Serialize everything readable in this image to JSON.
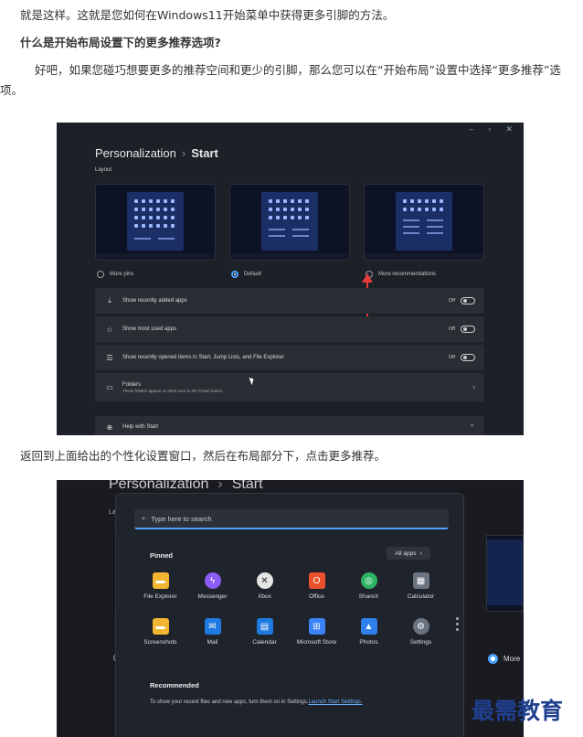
{
  "article": {
    "p1": "就是这样。这就是您如何在Windows11开始菜单中获得更多引脚的方法。",
    "heading": "什么是开始布局设置下的更多推荐选项?",
    "p2": "好吧，如果您碰巧想要更多的推荐空间和更少的引脚，那么您可以在“开始布局”设置中选择“更多推荐”选项。",
    "caption": "返回到上面给出的个性化设置窗口，然后在布局部分下，点击更多推荐。"
  },
  "shot1": {
    "window_controls": [
      "–",
      "▫",
      "✕"
    ],
    "breadcrumb_parent": "Personalization",
    "breadcrumb_sep": "›",
    "breadcrumb_current": "Start",
    "layout_label": "Layout",
    "options": [
      {
        "label": "More pins",
        "selected": false
      },
      {
        "label": "Default",
        "selected": true
      },
      {
        "label": "More recommendations",
        "selected": false
      }
    ],
    "rows": [
      {
        "icon": "download-icon",
        "label": "Show recently added apps",
        "state": "Off"
      },
      {
        "icon": "star-icon",
        "label": "Show most used apps",
        "state": "Off"
      },
      {
        "icon": "list-icon",
        "label": "Show recently opened items in Start, Jump Lists, and File Explorer",
        "state": "Off"
      },
      {
        "icon": "folder-icon",
        "label": "Folders",
        "sublabel": "These folders appear on Start next to the Power button"
      },
      {
        "icon": "globe-icon",
        "label": "Help with Start"
      }
    ],
    "accent": "#4da3ff",
    "arrow_color": "#e23b3b"
  },
  "shot2": {
    "bg_breadcrumb_parent": "Personalization",
    "bg_breadcrumb_sep": "›",
    "bg_breadcrumb_current": "Start",
    "bg_layout_fragment": "La",
    "bg_radio_label": "More",
    "search_placeholder": "Type here to search",
    "pinned_label": "Pinned",
    "all_apps_label": "All apps",
    "all_apps_chevron": "›",
    "apps": [
      {
        "name": "File Explorer",
        "icon": "file-explorer-icon",
        "color": "#f2b632"
      },
      {
        "name": "Messenger",
        "icon": "messenger-icon",
        "color": "#8b5cf6"
      },
      {
        "name": "Xbox",
        "icon": "xbox-icon",
        "color": "#e5e5e5"
      },
      {
        "name": "Office",
        "icon": "office-icon",
        "color": "#e8512b"
      },
      {
        "name": "ShareX",
        "icon": "sharex-icon",
        "color": "#2fb463"
      },
      {
        "name": "Calculator",
        "icon": "calculator-icon",
        "color": "#6b7280"
      },
      {
        "name": "Screenshots",
        "icon": "folder-icon",
        "color": "#f2b632"
      },
      {
        "name": "Mail",
        "icon": "mail-icon",
        "color": "#1f7ae0"
      },
      {
        "name": "Calendar",
        "icon": "calendar-icon",
        "color": "#1f7ae0"
      },
      {
        "name": "Microsoft Store",
        "icon": "store-icon",
        "color": "#3b82f6"
      },
      {
        "name": "Photos",
        "icon": "photos-icon",
        "color": "#2f80ed"
      },
      {
        "name": "Settings",
        "icon": "gear-icon",
        "color": "#6b7280"
      }
    ],
    "recommended_label": "Recommended",
    "recommended_text": "To show your recent files and new apps, turn them on in Settings.",
    "recommended_link": "Launch Start Settings."
  },
  "watermark": "最需教育"
}
